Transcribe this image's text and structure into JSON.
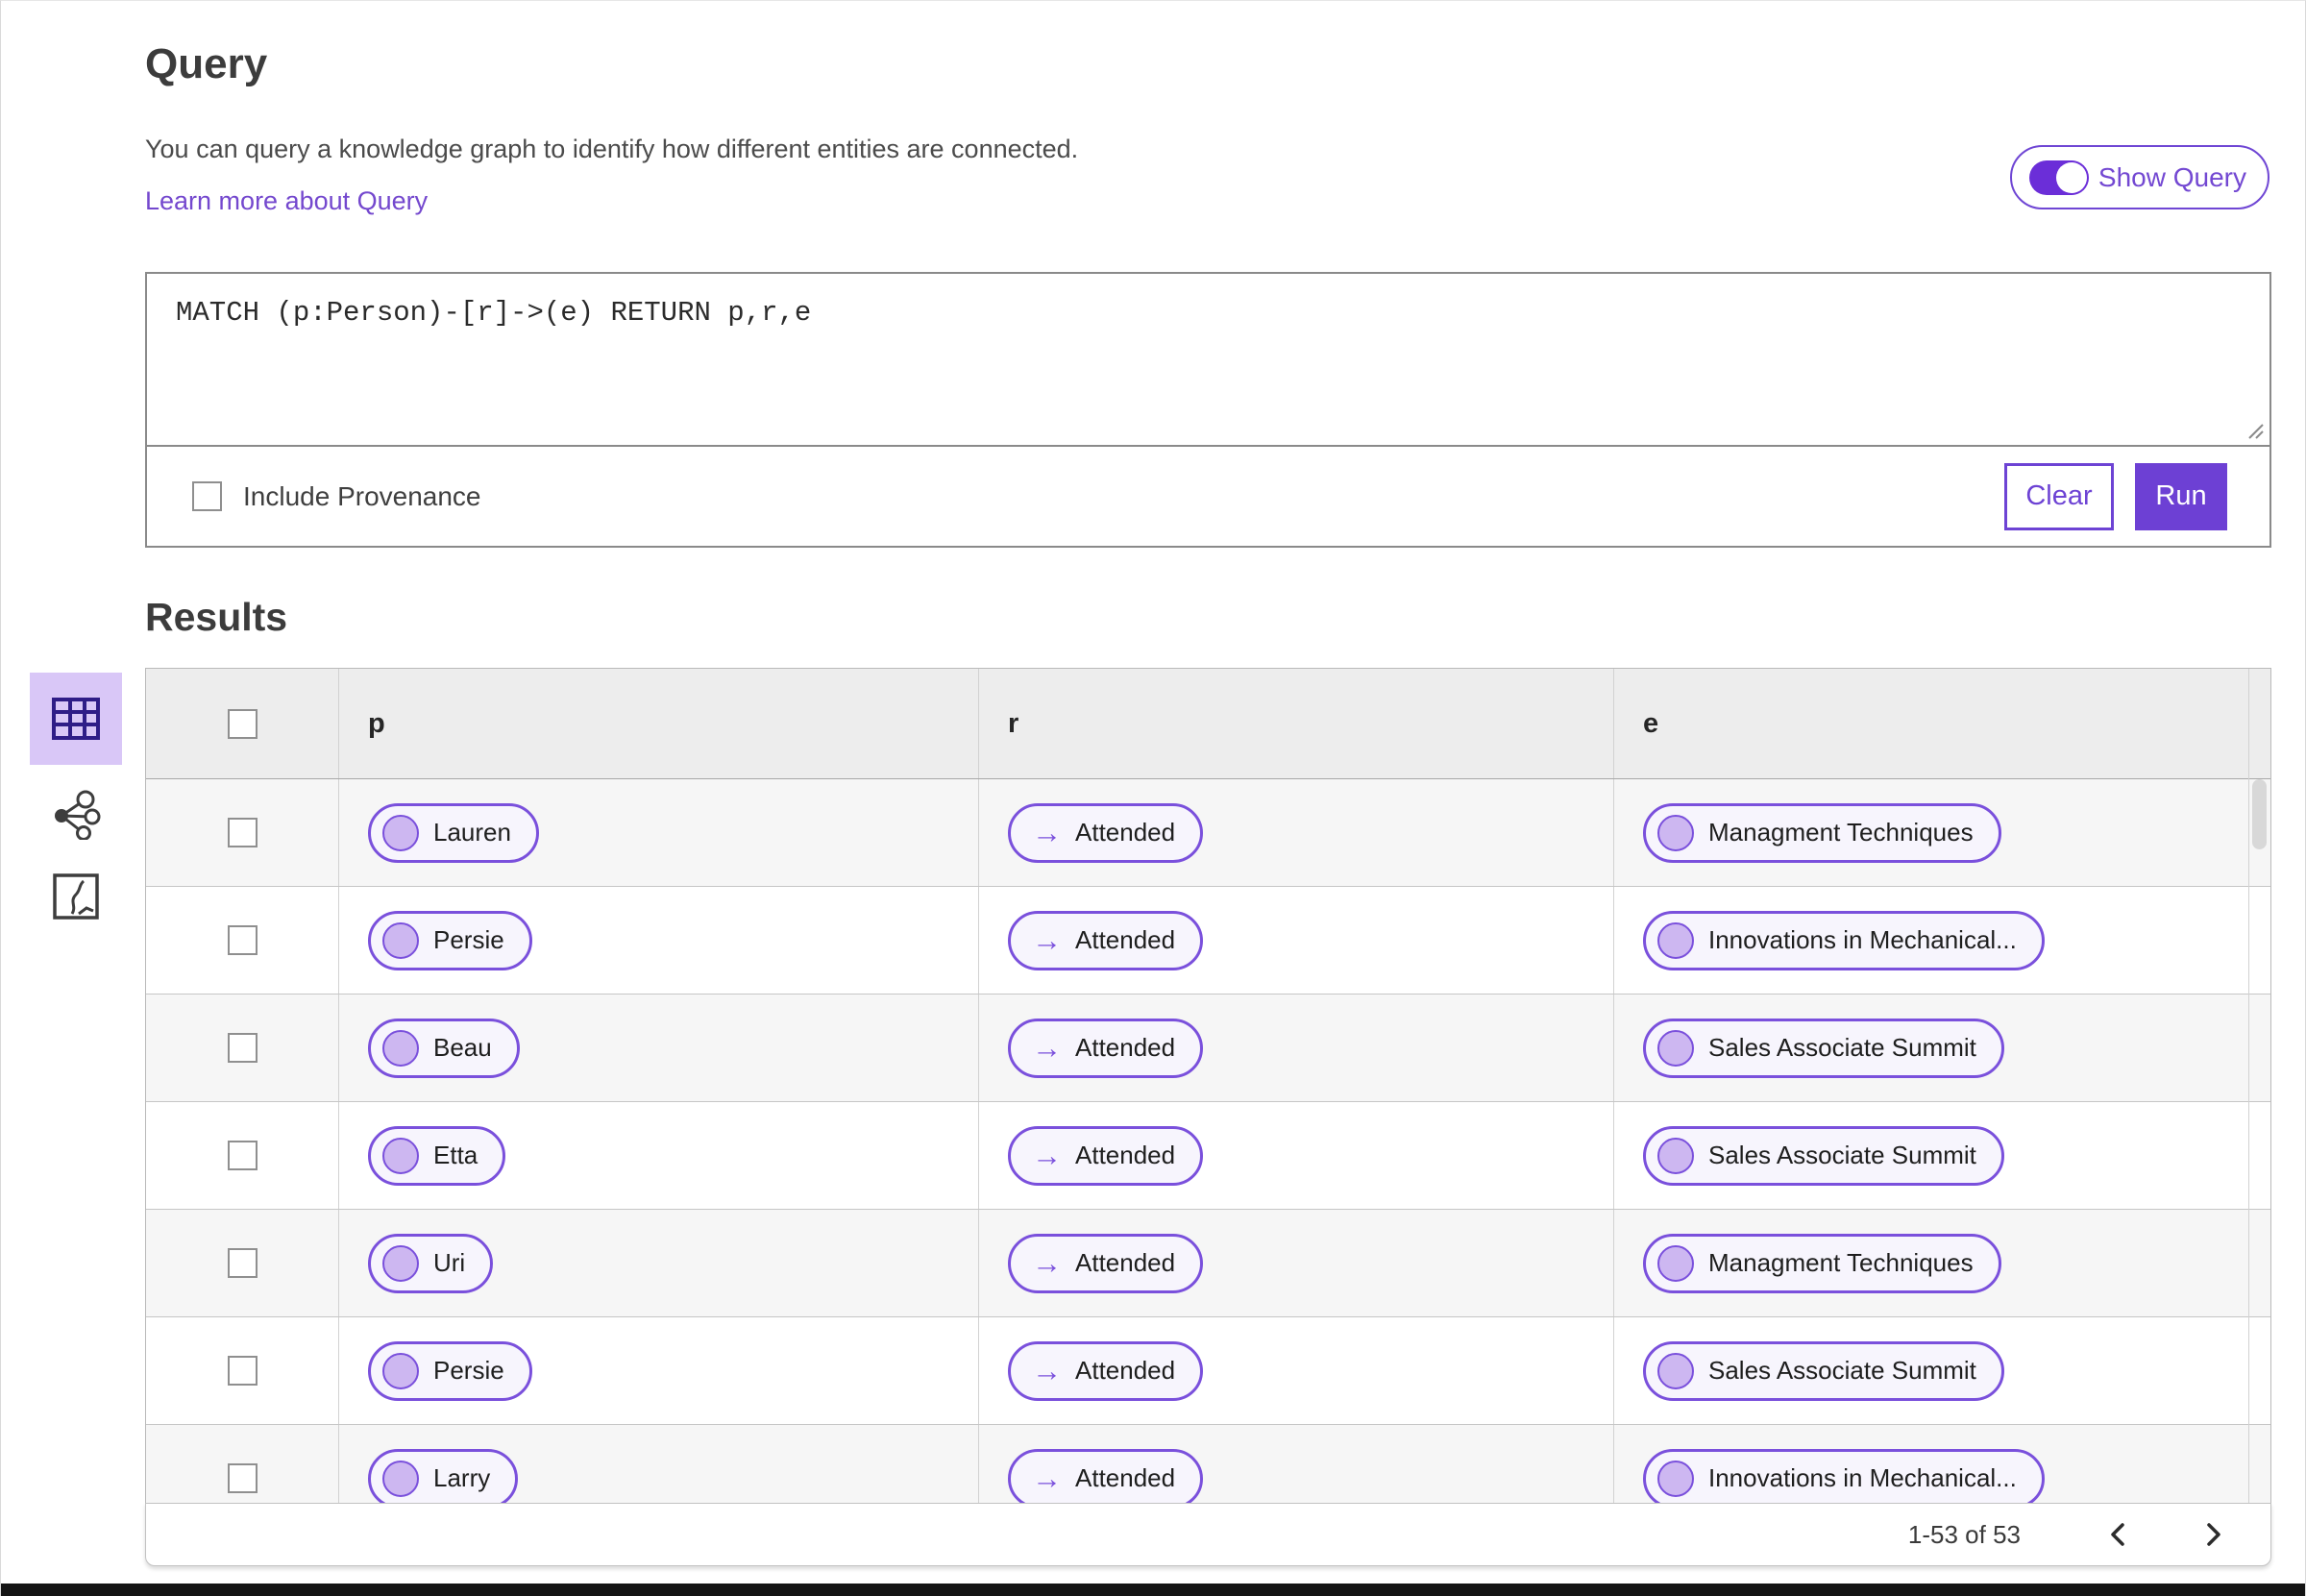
{
  "query_section": {
    "title": "Query",
    "description": "You can query a knowledge graph to identify how different entities are connected.",
    "learn_more_label": "Learn more about Query",
    "show_query_label": "Show Query",
    "show_query_on": true,
    "query_text": "MATCH (p:Person)-[r]->(e) RETURN p,r,e",
    "include_provenance_label": "Include Provenance",
    "include_provenance_checked": false,
    "clear_label": "Clear",
    "run_label": "Run"
  },
  "results_section": {
    "title": "Results",
    "views": [
      {
        "name": "table-view",
        "icon": "table-icon",
        "selected": true
      },
      {
        "name": "network-view",
        "icon": "network-graph-icon",
        "selected": false
      },
      {
        "name": "map-view",
        "icon": "map-icon",
        "selected": false
      }
    ],
    "table": {
      "columns": [
        "p",
        "r",
        "e"
      ],
      "rows": [
        {
          "p": "Lauren",
          "r": "Attended",
          "e": "Managment Techniques"
        },
        {
          "p": "Persie",
          "r": "Attended",
          "e": "Innovations in Mechanical..."
        },
        {
          "p": "Beau",
          "r": "Attended",
          "e": "Sales Associate Summit"
        },
        {
          "p": "Etta",
          "r": "Attended",
          "e": "Sales Associate Summit"
        },
        {
          "p": "Uri",
          "r": "Attended",
          "e": "Managment Techniques"
        },
        {
          "p": "Persie",
          "r": "Attended",
          "e": "Sales Associate Summit"
        },
        {
          "p": "Larry",
          "r": "Attended",
          "e": "Innovations in Mechanical..."
        }
      ]
    },
    "pagination": {
      "range_label": "1-53 of 53"
    }
  },
  "icons": {
    "relation_arrow": "→"
  },
  "colors": {
    "accent_purple": "#6D40D4",
    "pill_border": "#7A50DC",
    "pill_background": "#F7F5FD",
    "node_circle_fill": "#CDB7F1",
    "selected_view_background": "#D9C7F7",
    "link_purple": "#7448CE",
    "table_header_background": "#EDEDED",
    "zebra_row_background": "#F6F6F6",
    "toggle_track": "#6B2ED8"
  }
}
